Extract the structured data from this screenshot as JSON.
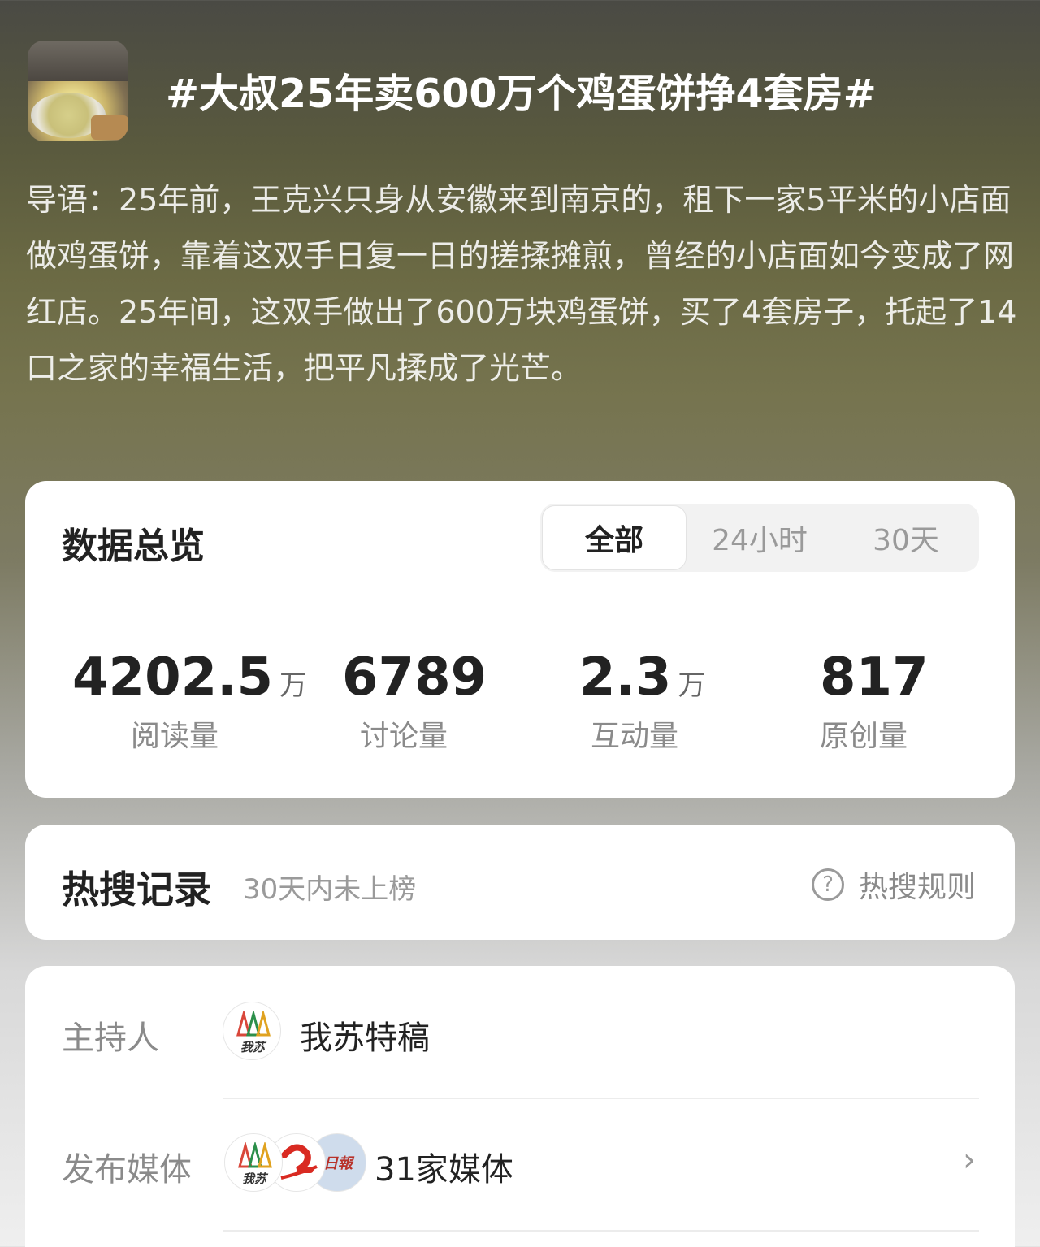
{
  "topic": {
    "title": "#大叔25年卖600万个鸡蛋饼挣4套房#",
    "intro": "导语：25年前，王克兴只身从安徽来到南京的，租下一家5平米的小店面做鸡蛋饼，靠着这双手日复一日的搓揉摊煎，曾经的小店面如今变成了网红店。25年间，这双手做出了600万块鸡蛋饼，买了4套房子，托起了14口之家的幸福生活，把平凡揉成了光芒。"
  },
  "overview": {
    "title": "数据总览",
    "tabs": [
      "全部",
      "24小时",
      "30天"
    ],
    "active_tab": "全部",
    "stats": [
      {
        "value": "4202.5",
        "unit": "万",
        "label": "阅读量"
      },
      {
        "value": "6789",
        "unit": "",
        "label": "讨论量"
      },
      {
        "value": "2.3",
        "unit": "万",
        "label": "互动量"
      },
      {
        "value": "817",
        "unit": "",
        "label": "原创量"
      }
    ]
  },
  "hot_search": {
    "title": "热搜记录",
    "status": "30天内未上榜",
    "rules_label": "热搜规则",
    "rules_icon": "question-circle-icon"
  },
  "host": {
    "label": "主持人",
    "name": "我苏特稿",
    "avatar_text": "我苏"
  },
  "media": {
    "label": "发布媒体",
    "count_text": "31家媒体",
    "avatar_texts": [
      "我苏",
      "日報"
    ]
  }
}
